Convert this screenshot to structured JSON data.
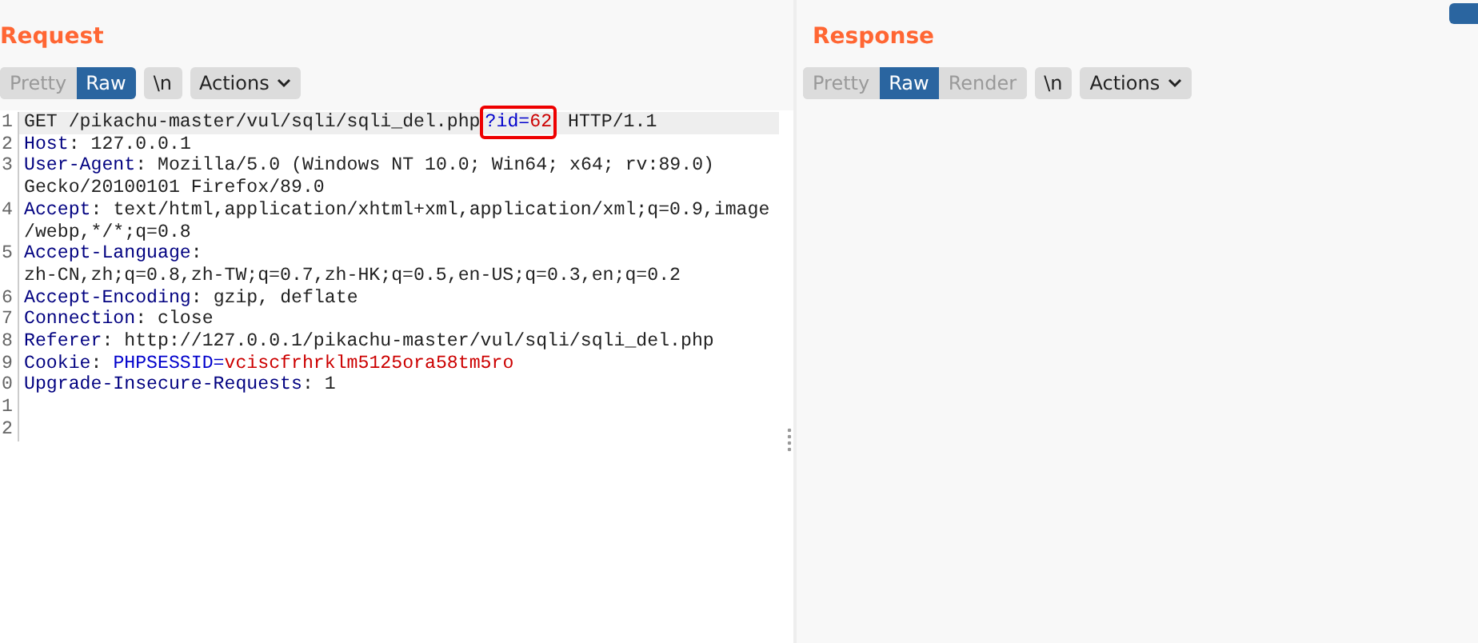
{
  "request": {
    "title": "Request",
    "view_tabs": [
      {
        "label": "Pretty",
        "selected": false
      },
      {
        "label": "Raw",
        "selected": true
      }
    ],
    "newline_toggle": {
      "label": "\\n",
      "on": false
    },
    "actions": {
      "label": "Actions"
    },
    "lines": [
      {
        "number": "1",
        "tokens": [
          {
            "kind": "plain",
            "text": "GET /pikachu-master/vul/sqli/sqli_del.php"
          },
          {
            "kind": "param_name",
            "text": "?id=",
            "highlighted": true
          },
          {
            "kind": "param_value",
            "text": "62",
            "highlighted": true
          },
          {
            "kind": "plain",
            "text": " HTTP/1.1"
          }
        ]
      },
      {
        "number": "2",
        "tokens": [
          {
            "kind": "header",
            "text": "Host"
          },
          {
            "kind": "plain",
            "text": ": 127.0.0.1"
          }
        ]
      },
      {
        "number": "3",
        "tokens": [
          {
            "kind": "header",
            "text": "User-Agent"
          },
          {
            "kind": "plain",
            "text": ": Mozilla/5.0 (Windows NT 10.0; Win64; x64; rv:89.0) Gecko/20100101 Firefox/89.0"
          }
        ]
      },
      {
        "number": "4",
        "tokens": [
          {
            "kind": "header",
            "text": "Accept"
          },
          {
            "kind": "plain",
            "text": ": text/html,application/xhtml+xml,application/xml;q=0.9,image/webp,*/*;q=0.8"
          }
        ]
      },
      {
        "number": "5",
        "tokens": [
          {
            "kind": "header",
            "text": "Accept-Language"
          },
          {
            "kind": "plain",
            "text": ": zh-CN,zh;q=0.8,zh-TW;q=0.7,zh-HK;q=0.5,en-US;q=0.3,en;q=0.2"
          }
        ]
      },
      {
        "number": "6",
        "tokens": [
          {
            "kind": "header",
            "text": "Accept-Encoding"
          },
          {
            "kind": "plain",
            "text": ": gzip, deflate"
          }
        ]
      },
      {
        "number": "7",
        "tokens": [
          {
            "kind": "header",
            "text": "Connection"
          },
          {
            "kind": "plain",
            "text": ": close"
          }
        ]
      },
      {
        "number": "8",
        "tokens": [
          {
            "kind": "header",
            "text": "Referer"
          },
          {
            "kind": "plain",
            "text": ": http://127.0.0.1/pikachu-master/vul/sqli/sqli_del.php"
          }
        ]
      },
      {
        "number": "9",
        "tokens": [
          {
            "kind": "header",
            "text": "Cookie"
          },
          {
            "kind": "plain",
            "text": ": "
          },
          {
            "kind": "param_name",
            "text": "PHPSESSID="
          },
          {
            "kind": "param_value",
            "text": "vciscfrhrklm5125ora58tm5ro"
          }
        ]
      },
      {
        "number": "0",
        "tokens": [
          {
            "kind": "header",
            "text": "Upgrade-Insecure-Requests"
          },
          {
            "kind": "plain",
            "text": ": 1"
          }
        ]
      },
      {
        "number": "1"
      },
      {
        "number": "2"
      }
    ]
  },
  "response": {
    "title": "Response",
    "view_tabs": [
      {
        "label": "Pretty",
        "selected": false
      },
      {
        "label": "Raw",
        "selected": true
      },
      {
        "label": "Render",
        "selected": false
      }
    ],
    "newline_toggle": {
      "label": "\\n",
      "on": false
    },
    "actions": {
      "label": "Actions"
    }
  }
}
